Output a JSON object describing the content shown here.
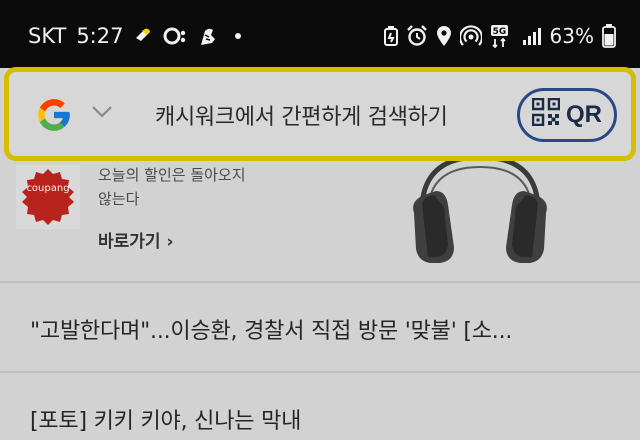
{
  "status_bar": {
    "carrier": "SKT",
    "time": "5:27",
    "battery": "63%",
    "network": "5G",
    "icons_left": [
      "chat-bubble-icon",
      "face-icon",
      "shoe-icon"
    ],
    "icons_right": [
      "battery-saver-icon",
      "alarm-icon",
      "location-icon",
      "hotspot-icon",
      "network-5g-icon",
      "signal-icon",
      "battery-icon"
    ]
  },
  "search": {
    "engine_icon": "google-g-icon",
    "placeholder": "캐시워크에서 간편하게 검색하기",
    "qr_label": "QR",
    "accent": "#d7bd00",
    "qr_border": "#274a86"
  },
  "ad": {
    "brand": "coupang",
    "line1": "오늘의 할인은 돌아오지",
    "line2": "않는다",
    "link_label": "바로가기 ›"
  },
  "news": [
    {
      "title": "\"고발한다며\"...이승환, 경찰서 직접 방문 '맞불' [소..."
    },
    {
      "title": "[포토] 키키 키야, 신나는 막내"
    }
  ]
}
